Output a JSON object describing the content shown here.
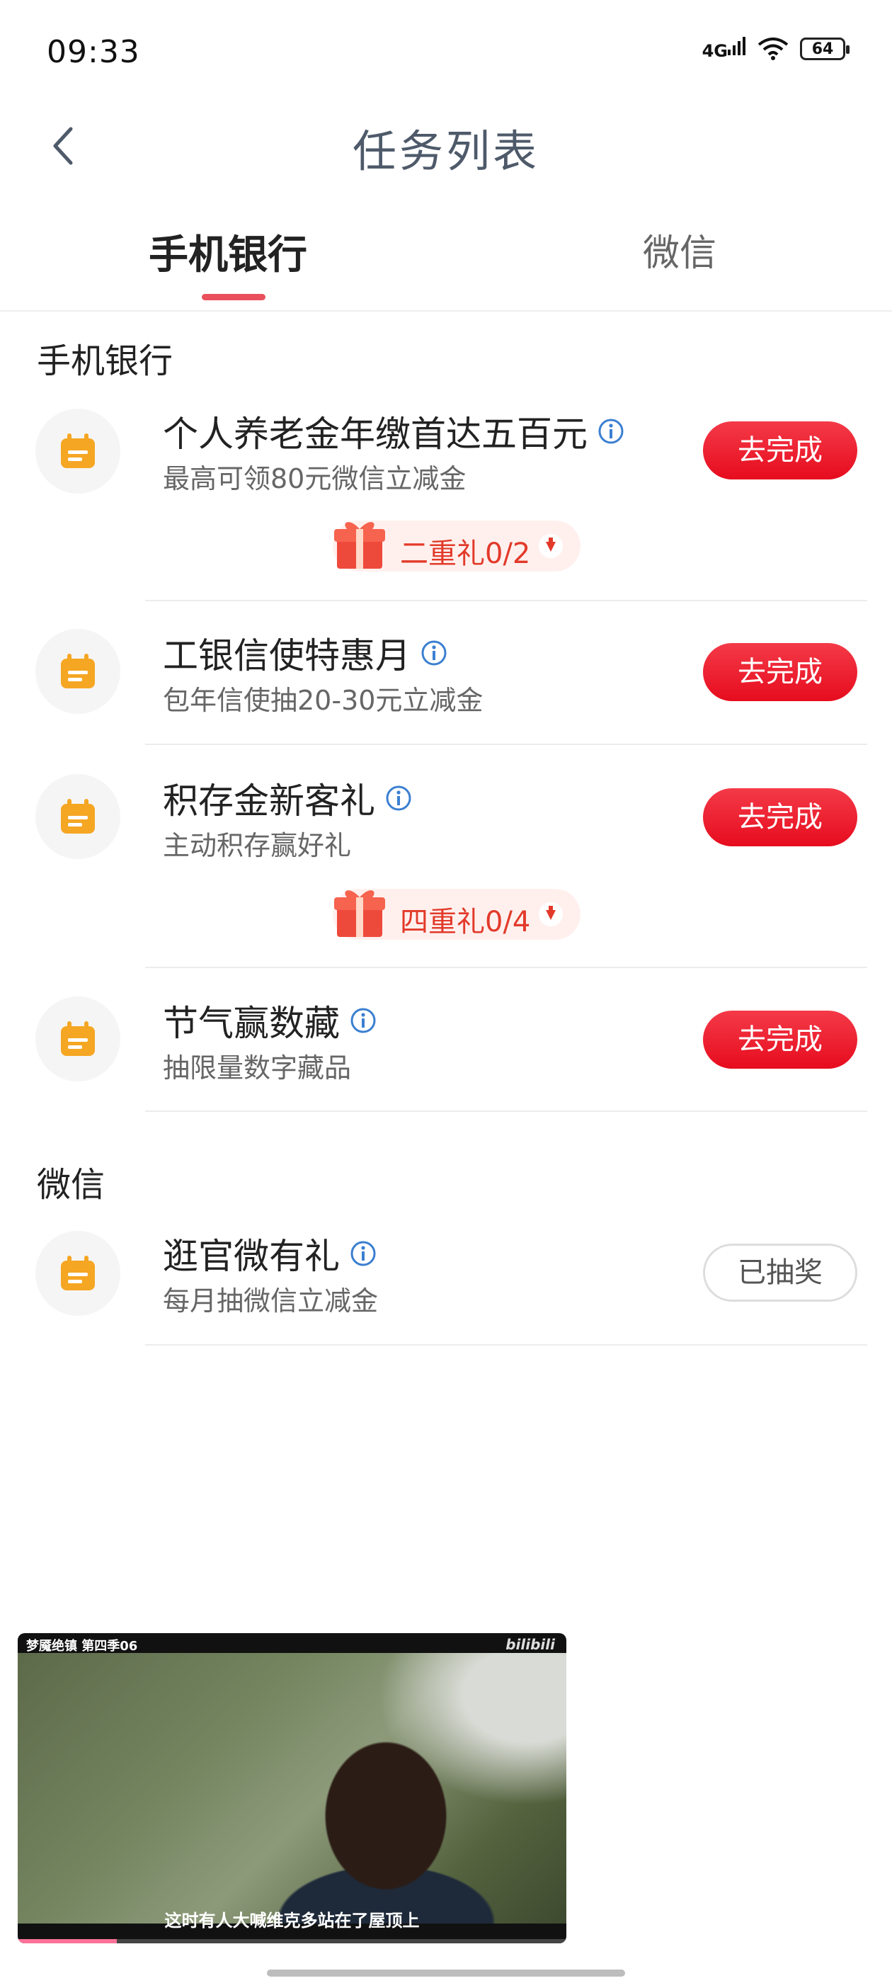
{
  "status": {
    "time": "09:33",
    "network": "4G",
    "battery": "64"
  },
  "header": {
    "title": "任务列表"
  },
  "tabs": [
    {
      "label": "手机银行",
      "active": true
    },
    {
      "label": "微信",
      "active": false
    }
  ],
  "sections": [
    {
      "title": "手机银行",
      "tasks": [
        {
          "title": "个人养老金年缴首达五百元",
          "subtitle": "最高可领80元微信立减金",
          "button": "去完成",
          "gift": "二重礼0/2"
        },
        {
          "title": "工银信使特惠月",
          "subtitle": "包年信使抽20-30元立减金",
          "button": "去完成"
        },
        {
          "title": "积存金新客礼",
          "subtitle": "主动积存赢好礼",
          "button": "去完成",
          "gift": "四重礼0/4"
        },
        {
          "title": "节气赢数藏",
          "subtitle": "抽限量数字藏品",
          "button": "去完成"
        }
      ]
    },
    {
      "title": "微信",
      "tasks": [
        {
          "title": "逛官微有礼",
          "subtitle": "每月抽微信立减金",
          "button": "已抽奖"
        }
      ]
    }
  ],
  "video": {
    "title": "梦魇绝镇 第四季06",
    "logo": "bilibili",
    "subtitle": "这时有人大喊维克多站在了屋顶上",
    "progress": 0.18
  },
  "colors": {
    "accent": "#e60c1e",
    "tab_underline": "#ea4f5c",
    "icon_orange": "#f5a623",
    "title_color": "#4e5a6a"
  }
}
